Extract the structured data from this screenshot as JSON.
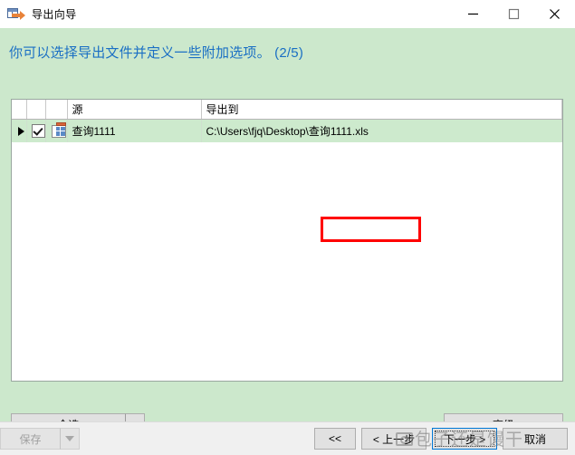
{
  "window": {
    "title": "导出向导",
    "icon": "export-wizard-icon",
    "controls": {
      "minimize": "minimize-icon",
      "maximize": "maximize-icon",
      "close": "close-icon"
    }
  },
  "header": {
    "headline": "你可以选择导出文件并定义一些附加选项。  (2/5)",
    "step_current": 2,
    "step_total": 5,
    "accent_color": "#1a6fc4",
    "background_color": "#cce8cc"
  },
  "grid": {
    "columns": [
      {
        "key": "indicator",
        "label": ""
      },
      {
        "key": "checkbox",
        "label": ""
      },
      {
        "key": "icon",
        "label": ""
      },
      {
        "key": "source",
        "label": "源"
      },
      {
        "key": "target",
        "label": "导出到"
      }
    ],
    "rows": [
      {
        "selected": true,
        "checked": true,
        "icon": "table-icon",
        "source": "查询1111",
        "target": "C:\\Users\\fjq\\Desktop\\查询1111.xls",
        "target_prefix": "C:\\Users\\fjq\\Desktop\\",
        "target_highlight": "查询1111.xls"
      }
    ]
  },
  "annotation": {
    "type": "red-rectangle",
    "color": "#ff0000",
    "targets_text": "查询1111.xls"
  },
  "actions": {
    "select_all_label": "全选",
    "select_all_dropdown": "chevron-down-icon",
    "advanced_label": "高级"
  },
  "footer": {
    "save_label": "保存",
    "save_disabled": true,
    "save_dropdown": "chevron-down-icon",
    "first_label": "<<",
    "prev_label": "< 上一步",
    "next_label": "下一步 >",
    "cancel_label": "取消",
    "next_focused": true
  },
  "watermark": {
    "text": "包子还是馒干",
    "prefix": "@",
    "icon": "camera-icon"
  }
}
